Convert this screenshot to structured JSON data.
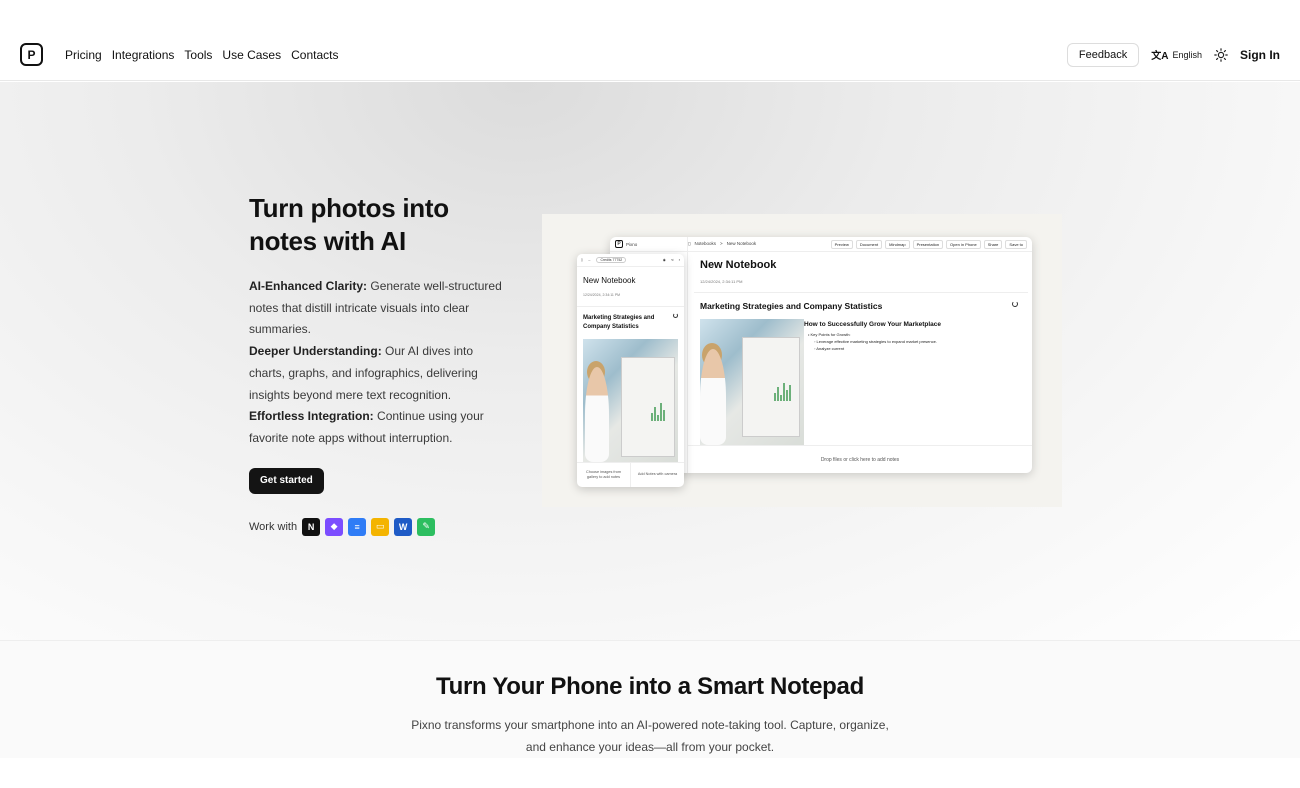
{
  "nav": {
    "logo_letter": "P",
    "links": [
      "Pricing",
      "Integrations",
      "Tools",
      "Use Cases",
      "Contacts"
    ],
    "feedback": "Feedback",
    "language": "English",
    "signin": "Sign In"
  },
  "hero": {
    "title": "Turn photos into notes with AI",
    "features": [
      {
        "label": "AI-Enhanced Clarity:",
        "text": " Generate well-structured notes that distill intricate visuals into clear summaries."
      },
      {
        "label": "Deeper Understanding:",
        "text": " Our AI dives into charts, graphs, and infographics, delivering insights beyond mere text recognition."
      },
      {
        "label": "Effortless Integration:",
        "text": " Continue using your favorite note apps without interruption."
      }
    ],
    "cta": "Get started",
    "work_with": "Work with",
    "apps": [
      {
        "name": "notion-icon",
        "glyph": "N",
        "color": "#111111"
      },
      {
        "name": "obsidian-icon",
        "glyph": "◆",
        "color": "#7c4dff"
      },
      {
        "name": "google-docs-icon",
        "glyph": "≡",
        "color": "#2f7cf6"
      },
      {
        "name": "google-slides-icon",
        "glyph": "▭",
        "color": "#f4b400"
      },
      {
        "name": "word-icon",
        "glyph": "W",
        "color": "#1f5bc6"
      },
      {
        "name": "evernote-icon",
        "glyph": "✎",
        "color": "#2dbe60"
      }
    ]
  },
  "mock_desktop": {
    "brand": "Pixno",
    "crumb_1": "Notebooks",
    "crumb_sep": ">",
    "crumb_2": "New Notebook",
    "tools": [
      "Preview",
      "Document",
      "Mindmap",
      "Presentation",
      "Open in Phone",
      "Share",
      "Save to"
    ],
    "title": "New Notebook",
    "date": "12/24/2024, 2:34:11 PM",
    "card_title": "Marketing Strategies and Company Statistics",
    "note_heading": "How to Successfully Grow Your Marketplace",
    "note_lines": [
      "• Key Points for Growth:",
      "◦ Leverage effective marketing strategies to expand market presence.",
      "◦ Analyze current"
    ],
    "drop": "Drop files or click here to add notes"
  },
  "mock_phone": {
    "pill": "Credits 77752",
    "title": "New Notebook",
    "date": "12/24/2024, 2:34:11 PM",
    "card_title": "Marketing Strategies and Company Statistics",
    "btn_gallery": "Choose images from gallery to add notes",
    "btn_camera": "Add Notes with camera"
  },
  "section2": {
    "title": "Turn Your Phone into a Smart Notepad",
    "subtitle": "Pixno transforms your smartphone into an AI-powered note-taking tool. Capture, organize, and enhance your ideas—all from your pocket."
  }
}
